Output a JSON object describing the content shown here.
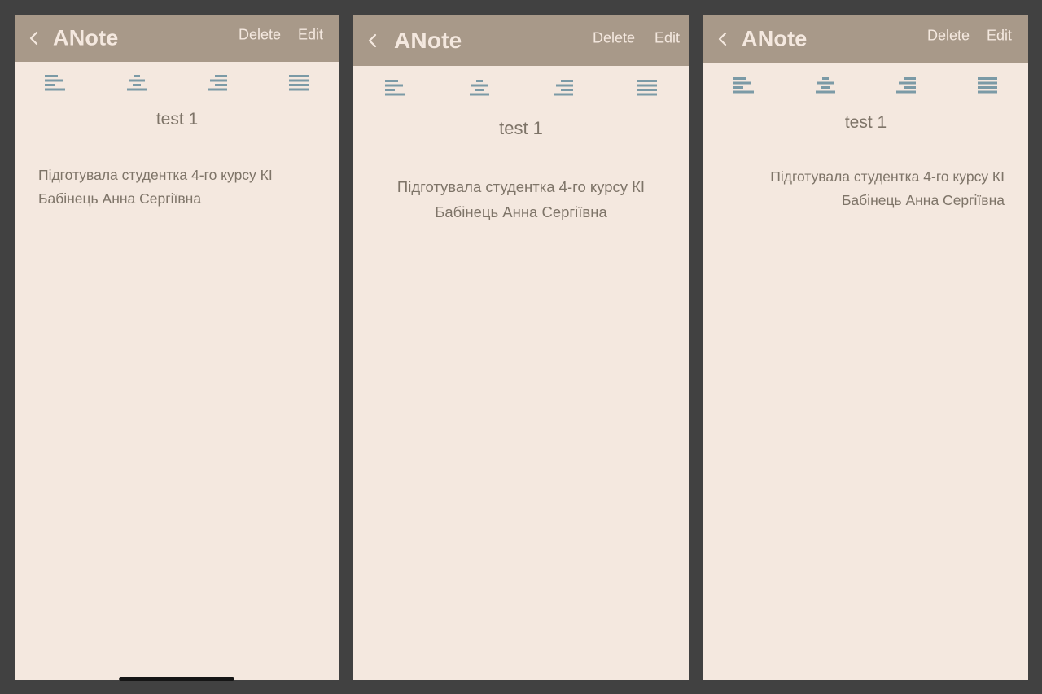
{
  "colors": {
    "background": "#414141",
    "screen_bg": "#f4e8df",
    "navbar_bg": "#a89989",
    "navbar_text": "#f4e8df",
    "icon_color": "#7b9aa6",
    "body_text": "#7e7468"
  },
  "screens": [
    {
      "navbar": {
        "back_icon": "chevron-left-icon",
        "title": "ANote",
        "delete_label": "Delete",
        "edit_label": "Edit"
      },
      "toolbar": [
        "align-left-icon",
        "align-center-icon",
        "align-right-icon",
        "align-justify-icon"
      ],
      "note": {
        "title": "test 1",
        "body_line_1": "Підготувала студентка 4-го курсу КІ",
        "body_line_2": "Бабінець Анна Сергіївна",
        "alignment": "left"
      }
    },
    {
      "navbar": {
        "back_icon": "chevron-left-icon",
        "title": "ANote",
        "delete_label": "Delete",
        "edit_label": "Edit"
      },
      "toolbar": [
        "align-left-icon",
        "align-center-icon",
        "align-right-icon",
        "align-justify-icon"
      ],
      "note": {
        "title": "test 1",
        "body_line_1": "Підготувала студентка 4-го курсу КІ",
        "body_line_2": "Бабінець Анна Сергіївна",
        "alignment": "center"
      }
    },
    {
      "navbar": {
        "back_icon": "chevron-left-icon",
        "title": "ANote",
        "delete_label": "Delete",
        "edit_label": "Edit"
      },
      "toolbar": [
        "align-left-icon",
        "align-center-icon",
        "align-right-icon",
        "align-justify-icon"
      ],
      "note": {
        "title": "test 1",
        "body_line_1": "Підготувала студентка 4-го курсу КІ",
        "body_line_2": "Бабінець Анна Сергіївна",
        "alignment": "right"
      }
    }
  ]
}
